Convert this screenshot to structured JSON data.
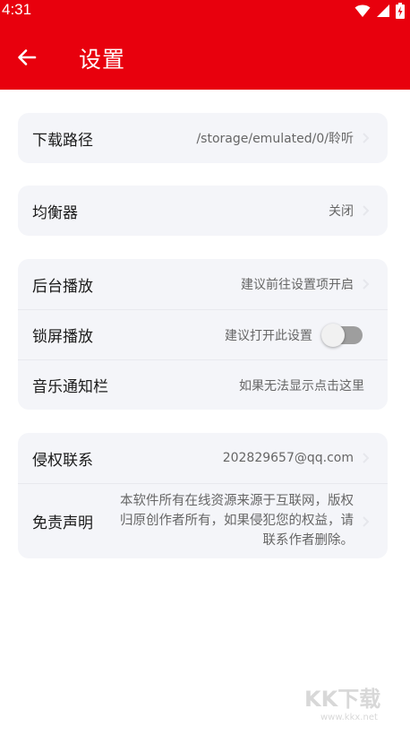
{
  "status": {
    "time": "4:31"
  },
  "header": {
    "title": "设置"
  },
  "colors": {
    "accent": "#e8000d",
    "card": "#f4f5f9"
  },
  "sections": {
    "download": {
      "label": "下载路径",
      "value": "/storage/emulated/0/聆听"
    },
    "equalizer": {
      "label": "均衡器",
      "value": "关闭"
    },
    "background_play": {
      "label": "后台播放",
      "value": "建议前往设置项开启"
    },
    "lockscreen_play": {
      "label": "锁屏播放",
      "value": "建议打开此设置",
      "toggle_on": false
    },
    "notification": {
      "label": "音乐通知栏",
      "value": "如果无法显示点击这里"
    },
    "copyright": {
      "label": "侵权联系",
      "value": "202829657@qq.com"
    },
    "disclaimer": {
      "label": "免责声明",
      "value": "本软件所有在线资源来源于互联网，版权归原创作者所有，如果侵犯您的权益，请联系作者删除。"
    }
  },
  "watermark": {
    "text": "KK下载",
    "url": "www.kkx.net"
  }
}
